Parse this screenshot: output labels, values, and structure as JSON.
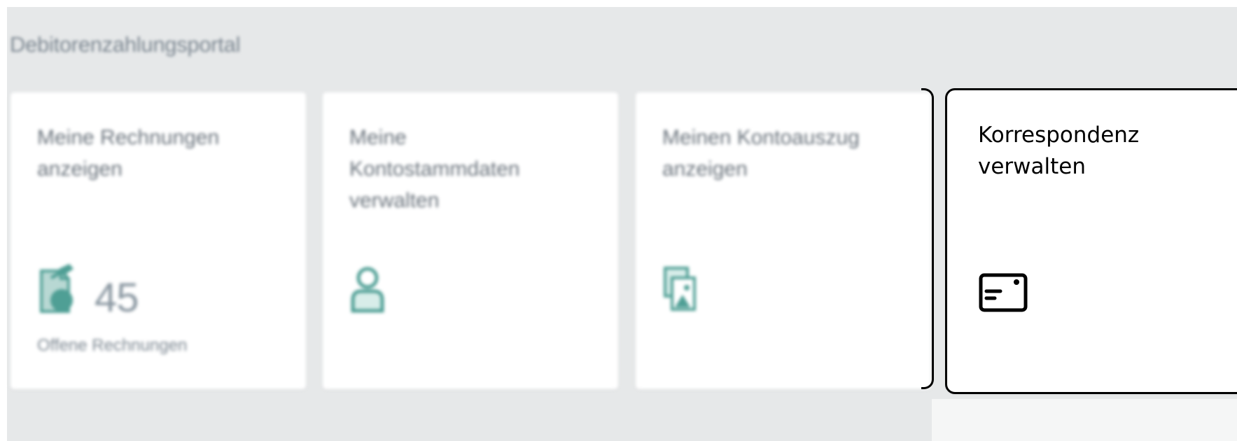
{
  "page": {
    "title": "Debitorenzahlungsportal"
  },
  "tiles": [
    {
      "title": "Meine Rechnungen anzeigen",
      "icon": "open-invoices-icon",
      "kpi_value": "45",
      "kpi_label": "Offene Rechnungen"
    },
    {
      "title": "Meine Kontostammdaten verwalten",
      "icon": "person-icon"
    },
    {
      "title": "Meinen Kontoauszug anzeigen",
      "icon": "account-statement-icon"
    },
    {
      "title": "Korrespondenz verwalten",
      "icon": "correspondence-icon"
    }
  ],
  "colors": {
    "page_background": "#e6e8e9",
    "tile_background": "#ffffff",
    "icon_teal": "#4f9f95",
    "focus_border": "#000000",
    "muted_text": "#6a737c"
  }
}
